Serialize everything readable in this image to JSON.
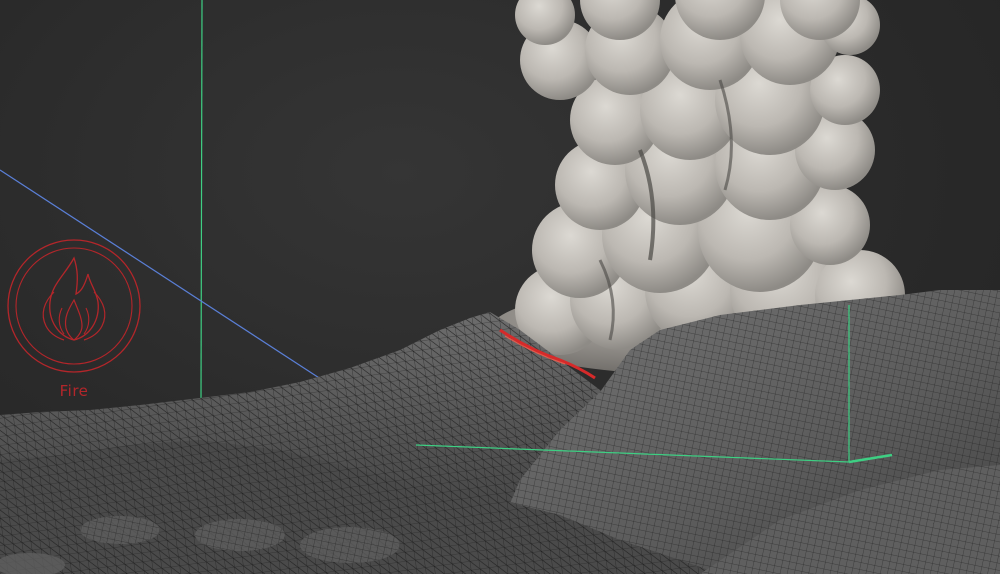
{
  "viewport": {
    "background_color": "#2b2b2b"
  },
  "fire_helper": {
    "label": "Fire",
    "icon": "flame-icon",
    "color": "#b3262a"
  },
  "gizmo": {
    "x_axis_color": "#5a7fd6",
    "y_axis_color": "#3ecf83",
    "z_axis_color": "#3ecf83"
  },
  "smoke": {
    "color": "#c9c6c1"
  },
  "terrain": {
    "wire_color": "#1c1c1c",
    "surface_color": "#5a5a5a"
  },
  "lava": {
    "color": "#d62a2a"
  }
}
